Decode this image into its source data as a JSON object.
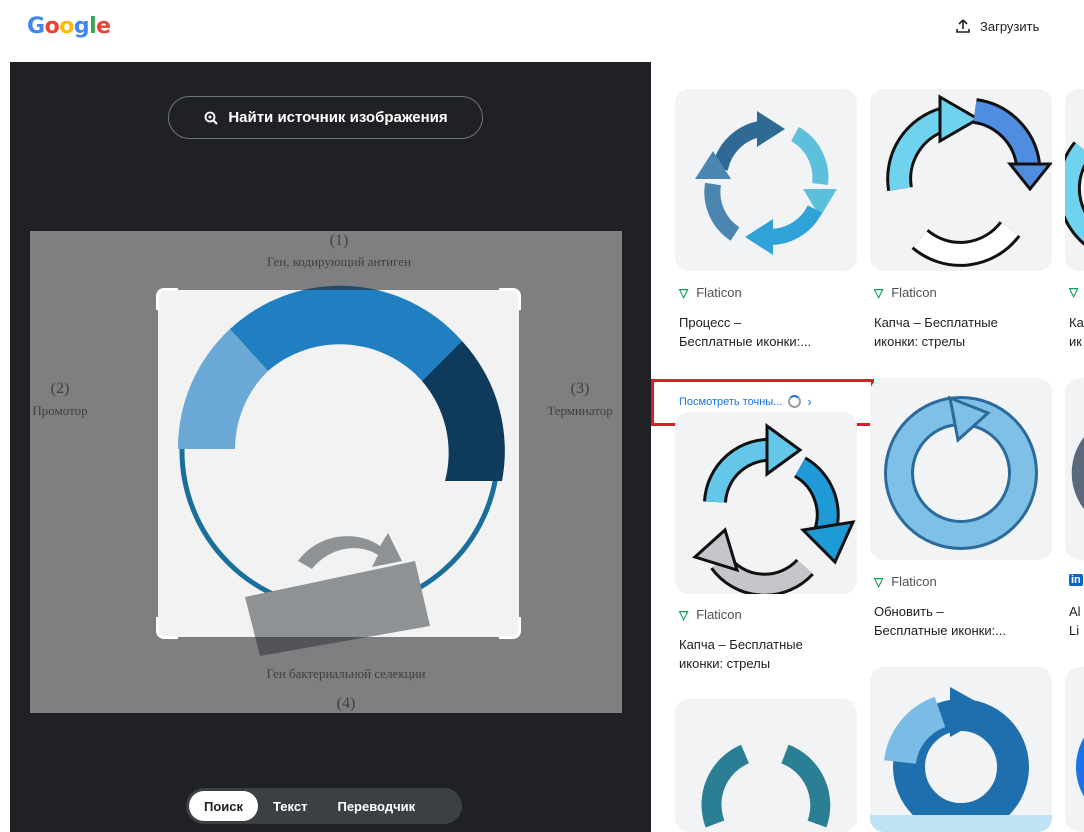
{
  "header": {
    "logo": "Google",
    "logo_colors": [
      "#4285F4",
      "#EA4335",
      "#FBBC05",
      "#4285F4",
      "#34A853",
      "#EA4335"
    ],
    "upload_label": "Загрузить"
  },
  "viewer": {
    "find_source_label": "Найти источник изображения",
    "diagram_labels": {
      "top_num": "(1)",
      "top_text": "Ген, кодирующий антиген",
      "left_num": "(2)",
      "left_text": "Промотор",
      "right_num": "(3)",
      "right_text": "Терминатор",
      "bottom_text": "Ген бактериальной селекции",
      "bottom_num": "(4)"
    },
    "modes": [
      {
        "label": "Поиск",
        "active": true
      },
      {
        "label": "Текст",
        "active": false
      },
      {
        "label": "Переводчик",
        "active": false
      }
    ]
  },
  "results": {
    "items": [
      {
        "source": "Flaticon",
        "title_line1": "Процесс –",
        "title_line2": "Бесплатные иконки:..."
      },
      {
        "source": "Flaticon",
        "title_line1": "Капча – Бесплатные",
        "title_line2": "иконки: стрелы"
      },
      {
        "source": "",
        "title_line1": "Ка",
        "title_line2": "ик"
      },
      {
        "source": "Flaticon",
        "title_line1": "Капча – Бесплатные",
        "title_line2": "иконки: стрелы"
      },
      {
        "source": "Flaticon",
        "title_line1": "Обновить –",
        "title_line2": "Бесплатные иконки:..."
      },
      {
        "source": "in",
        "title_line1": "Al",
        "title_line2": "Li"
      }
    ],
    "exact_match_label": "Посмотреть точны...",
    "highlight_color": "#E01B24"
  }
}
